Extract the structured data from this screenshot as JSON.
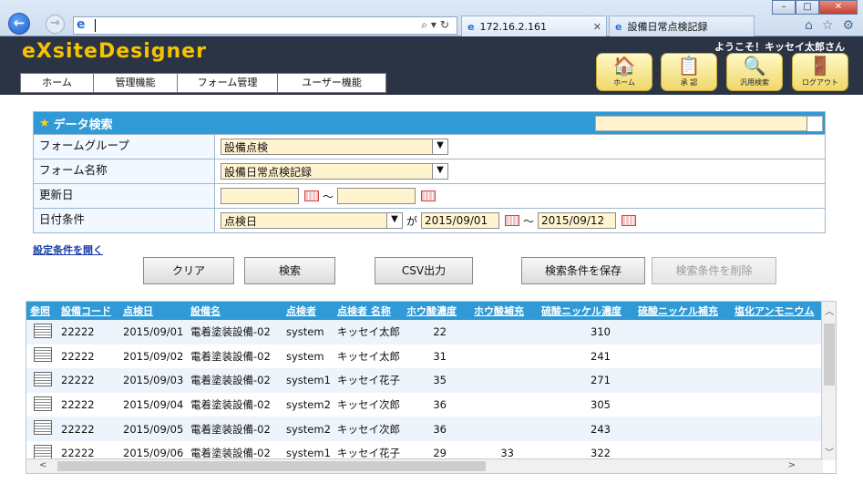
{
  "browser": {
    "tabs": [
      {
        "label": "172.16.2.161"
      },
      {
        "label": "設備日常点検記録"
      }
    ]
  },
  "app": {
    "logo": "eXsiteDesigner",
    "welcome": "ようこそ！キッセイ太郎さん",
    "menu": [
      "ホーム",
      "管理機能",
      "フォーム管理",
      "ユーザー機能"
    ],
    "header_buttons": [
      {
        "label": "ホーム",
        "icon": "house-icon"
      },
      {
        "label": "承 認",
        "icon": "stamp-icon"
      },
      {
        "label": "汎用検索",
        "icon": "magnifier-icon"
      },
      {
        "label": "ログアウト",
        "icon": "logout-icon"
      }
    ]
  },
  "search": {
    "title": "データ検索",
    "fields": {
      "form_group_label": "フォームグループ",
      "form_group_value": "設備点検",
      "form_name_label": "フォーム名称",
      "form_name_value": "設備日常点検記録",
      "updated_label": "更新日",
      "updated_from": "",
      "range_sep": "～",
      "updated_to": "",
      "date_cond_label": "日付条件",
      "date_cond_value": "点検日",
      "ga": "が",
      "date_from": "2015/09/01",
      "date_to": "2015/09/12"
    },
    "open_link": "設定条件を開く",
    "buttons": {
      "clear": "クリア",
      "search": "検索",
      "csv": "CSV出力",
      "save": "検索条件を保存",
      "delete": "検索条件を削除"
    }
  },
  "grid": {
    "columns": [
      "参照",
      "設備コード",
      "点検日",
      "設備名",
      "点検者",
      "点検者 名称",
      "ホウ酸濃度",
      "ホウ酸補充",
      "硫酸ニッケル濃度",
      "硫酸ニッケル補充",
      "塩化アンモニウム"
    ],
    "rows": [
      [
        "22222",
        "2015/09/01",
        "電着塗装設備-02",
        "system",
        "キッセイ太郎",
        "22",
        "",
        "310",
        ""
      ],
      [
        "22222",
        "2015/09/02",
        "電着塗装設備-02",
        "system",
        "キッセイ太郎",
        "31",
        "",
        "241",
        ""
      ],
      [
        "22222",
        "2015/09/03",
        "電着塗装設備-02",
        "system1",
        "キッセイ花子",
        "35",
        "",
        "271",
        ""
      ],
      [
        "22222",
        "2015/09/04",
        "電着塗装設備-02",
        "system2",
        "キッセイ次郎",
        "36",
        "",
        "305",
        ""
      ],
      [
        "22222",
        "2015/09/05",
        "電着塗装設備-02",
        "system2",
        "キッセイ次郎",
        "36",
        "",
        "243",
        ""
      ],
      [
        "22222",
        "2015/09/06",
        "電着塗装設備-02",
        "system1",
        "キッセイ花子",
        "29",
        "33",
        "322",
        ""
      ]
    ]
  }
}
